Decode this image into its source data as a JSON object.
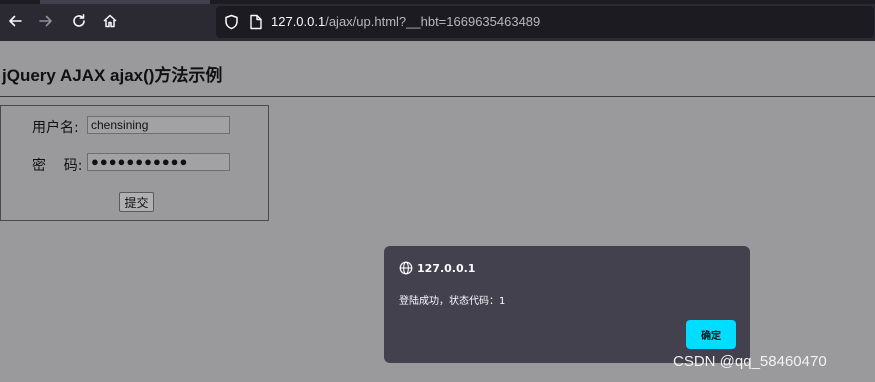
{
  "browser": {
    "url_host": "127.0.0.1",
    "url_path": "/ajax/up.html?__hbt=1669635463489"
  },
  "page": {
    "title": "jQuery AJAX ajax()方法示例",
    "form": {
      "username_label": "用户名:",
      "username_value": "chensining",
      "password_label": "密    码:",
      "password_mask": "●●●●●●●●●●●",
      "submit_label": "提交"
    }
  },
  "dialog": {
    "origin": "127.0.0.1",
    "message": "登陆成功，状态代码：1",
    "ok_label": "确定"
  },
  "watermark": "CSDN @qq_58460470",
  "colors": {
    "dialog_button": "#00ddff",
    "toolbar": "#2b2a33",
    "dialog_bg": "#42414d"
  },
  "icons": [
    "back-icon",
    "forward-icon",
    "reload-icon",
    "home-icon",
    "shield-icon",
    "page-icon",
    "globe-icon"
  ]
}
